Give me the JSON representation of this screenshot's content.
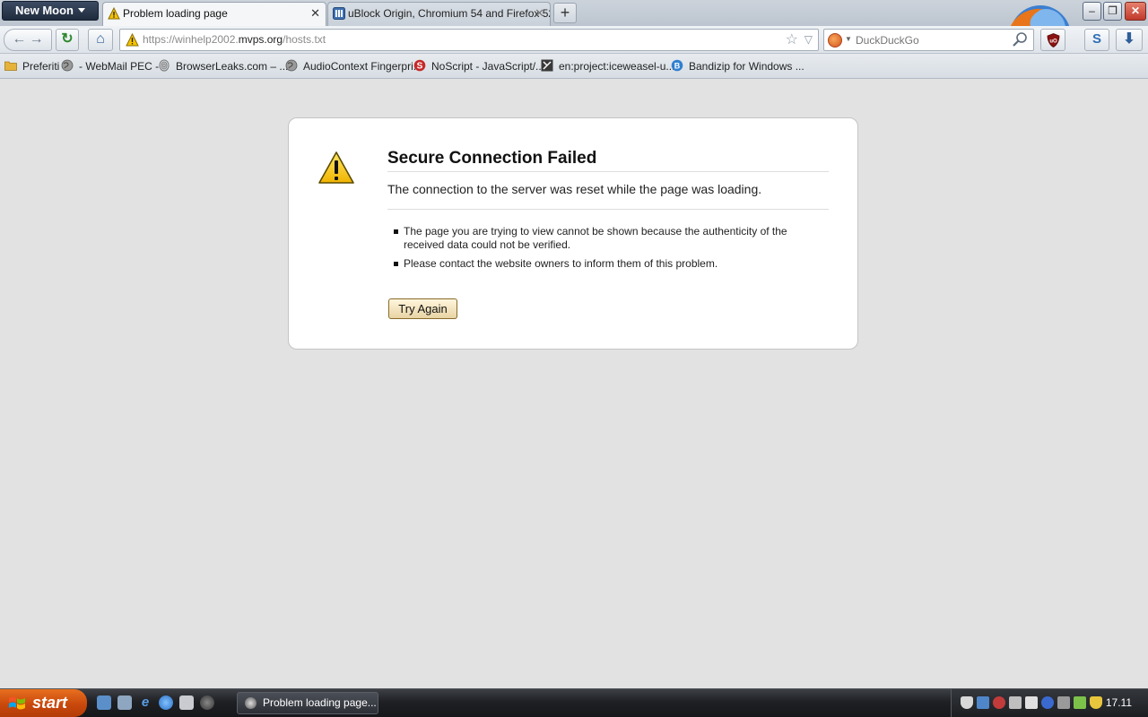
{
  "browser": {
    "app_menu_label": "New Moon",
    "tabs": [
      {
        "label": "Problem loading page",
        "icon": "warning-icon",
        "active": true,
        "close": "✕"
      },
      {
        "label": "uBlock Origin, Chromium 54 and Firefox 52...",
        "icon": "forum-icon",
        "active": false,
        "close": "✕"
      }
    ],
    "new_tab_label": "+",
    "window_controls": {
      "minimize": "–",
      "maximize": "❐",
      "close": "✕"
    }
  },
  "navbar": {
    "url_prefix": "https://winhelp2002.",
    "url_host": "mvps.org",
    "url_suffix": "/hosts.txt",
    "search_engine": "duckduckgo-icon",
    "search_placeholder": "DuckDuckGo",
    "s_button_label": "S"
  },
  "bookmarks": [
    {
      "label": "Preferiti",
      "icon": "folder-icon",
      "color": "#e6b33a"
    },
    {
      "label": "- WebMail PEC -",
      "icon": "globe-icon",
      "color": "#8e8e8e"
    },
    {
      "label": "BrowserLeaks.com – ...",
      "icon": "fingerprint-icon",
      "color": "#8e8e8e"
    },
    {
      "label": "AudioContext Fingerpri...",
      "icon": "globe-icon",
      "color": "#8e8e8e"
    },
    {
      "label": "NoScript - JavaScript/...",
      "icon": "noscript-icon",
      "color": "#c62828"
    },
    {
      "label": "en:project:iceweasel-u...",
      "icon": "tools-icon",
      "color": "#444444"
    },
    {
      "label": "Bandizip for Windows ...",
      "icon": "bandizip-icon",
      "color": "#2f7fd1"
    }
  ],
  "error_page": {
    "title": "Secure Connection Failed",
    "short_description": "The connection to the server was reset while the page was loading.",
    "details": [
      "The page you are trying to view cannot be shown because the authenticity of the received data could not be verified.",
      "Please contact the website owners to inform them of this problem."
    ],
    "try_again_label": "Try Again"
  },
  "taskbar": {
    "start_label": "start",
    "task_label": "Problem loading page...",
    "clock": "17.11"
  },
  "colors": {
    "accent_start": "#c9480c",
    "warning_yellow": "#f5c400",
    "page_background": "#e2e2e2"
  }
}
